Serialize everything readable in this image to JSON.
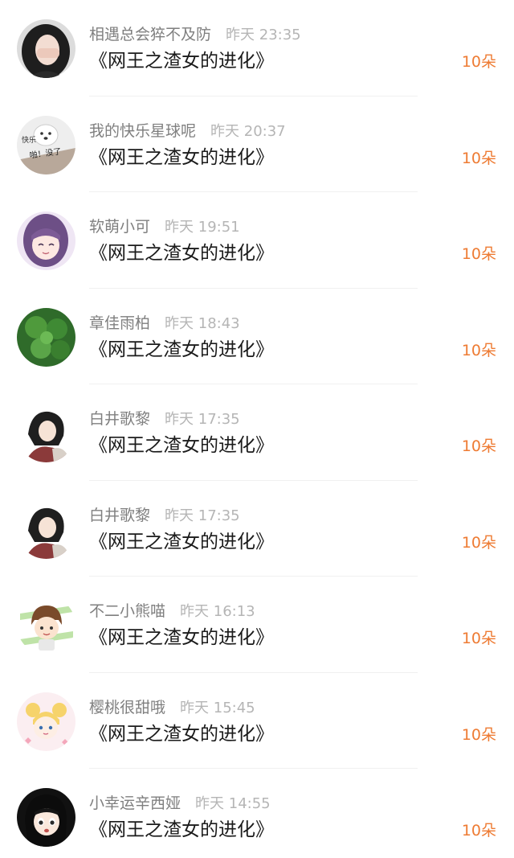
{
  "records": [
    {
      "name": "相遇总会猝不及防",
      "time": "昨天 23:35",
      "title": "《网王之渣女的进化》",
      "gift": "10朵",
      "avatar": "girl-face-avatar"
    },
    {
      "name": "我的快乐星球呢",
      "time": "昨天 20:37",
      "title": "《网王之渣女的进化》",
      "gift": "10朵",
      "avatar": "dog-meme-avatar",
      "avatar_text": [
        "快乐",
        "啪！没了"
      ]
    },
    {
      "name": "软萌小可",
      "time": "昨天 19:51",
      "title": "《网王之渣女的进化》",
      "gift": "10朵",
      "avatar": "anime-girl-avatar"
    },
    {
      "name": "章佳雨柏",
      "time": "昨天 18:43",
      "title": "《网王之渣女的进化》",
      "gift": "10朵",
      "avatar": "green-clover-avatar"
    },
    {
      "name": "白井歌黎",
      "time": "昨天 17:35",
      "title": "《网王之渣女的进化》",
      "gift": "10朵",
      "avatar": "anime-woman-avatar"
    },
    {
      "name": "白井歌黎",
      "time": "昨天 17:35",
      "title": "《网王之渣女的进化》",
      "gift": "10朵",
      "avatar": "anime-woman-avatar"
    },
    {
      "name": "不二小熊喵",
      "time": "昨天 16:13",
      "title": "《网王之渣女的进化》",
      "gift": "10朵",
      "avatar": "chibi-boy-avatar"
    },
    {
      "name": "樱桃很甜哦",
      "time": "昨天 15:45",
      "title": "《网王之渣女的进化》",
      "gift": "10朵",
      "avatar": "sailor-moon-avatar"
    },
    {
      "name": "小幸运辛西娅",
      "time": "昨天 14:55",
      "title": "《网王之渣女的进化》",
      "gift": "10朵",
      "avatar": "dark-hair-girl-avatar"
    }
  ]
}
